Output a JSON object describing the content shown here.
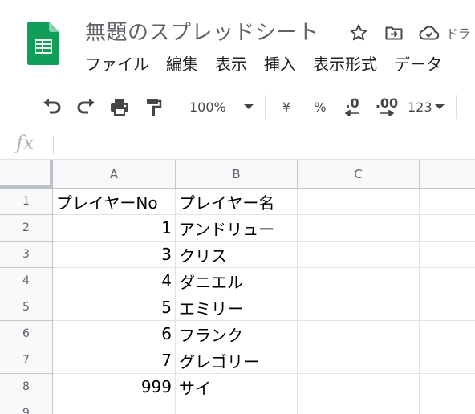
{
  "document": {
    "title": "無題のスプレッドシート",
    "drive_status_label": "ドラ"
  },
  "menu": [
    "ファイル",
    "編集",
    "表示",
    "挿入",
    "表示形式",
    "データ"
  ],
  "toolbar": {
    "zoom": "100%",
    "currency": "¥",
    "percent": "%",
    "decrease_decimal": ".0",
    "increase_decimal": ".00",
    "number_format": "123"
  },
  "formula_bar": {
    "fx_label": "fx",
    "value": ""
  },
  "sheet": {
    "columns": [
      "A",
      "B",
      "C"
    ],
    "rows": [
      {
        "num": "1",
        "A": "プレイヤーNo",
        "B": "プレイヤー名",
        "C": ""
      },
      {
        "num": "2",
        "A": "1",
        "B": "アンドリュー",
        "C": ""
      },
      {
        "num": "3",
        "A": "3",
        "B": "クリス",
        "C": ""
      },
      {
        "num": "4",
        "A": "4",
        "B": "ダニエル",
        "C": ""
      },
      {
        "num": "5",
        "A": "5",
        "B": "エミリー",
        "C": ""
      },
      {
        "num": "6",
        "A": "6",
        "B": "フランク",
        "C": ""
      },
      {
        "num": "7",
        "A": "7",
        "B": "グレゴリー",
        "C": ""
      },
      {
        "num": "8",
        "A": "999",
        "B": "サイ",
        "C": ""
      },
      {
        "num": "9",
        "A": "",
        "B": "",
        "C": ""
      }
    ]
  },
  "icons": {
    "app": "google-sheets-icon",
    "star": "star-icon",
    "move": "folder-move-icon",
    "cloud": "cloud-saved-icon",
    "undo": "undo-icon",
    "redo": "redo-icon",
    "print": "print-icon",
    "paint_format": "paint-format-icon",
    "dropdown": "chevron-down-icon"
  },
  "colors": {
    "sheets_green": "#0f9d58",
    "header_bg": "#f8f9fa",
    "grid_line": "#e2e3e3"
  }
}
